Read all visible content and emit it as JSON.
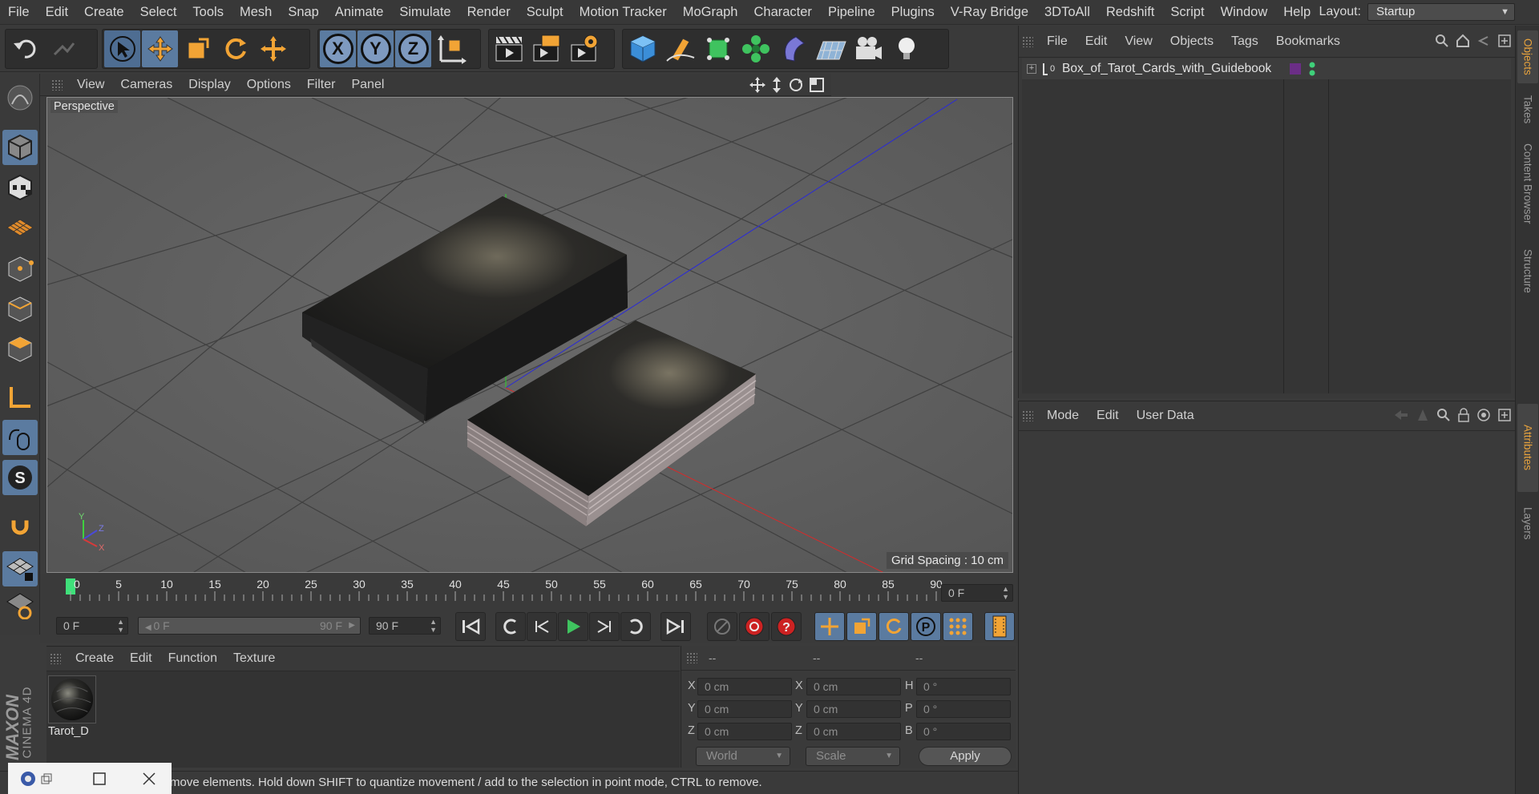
{
  "menubar": {
    "items": [
      "File",
      "Edit",
      "Create",
      "Select",
      "Tools",
      "Mesh",
      "Snap",
      "Animate",
      "Simulate",
      "Render",
      "Sculpt",
      "Motion Tracker",
      "MoGraph",
      "Character",
      "Pipeline",
      "Plugins",
      "V-Ray Bridge",
      "3DToAll",
      "Redshift",
      "Script",
      "Window",
      "Help"
    ],
    "layout_label": "Layout:",
    "layout_value": "Startup"
  },
  "toolbar": {
    "undo_icon": "undo-icon",
    "redo_icon": "redo-icon",
    "axis_x": "X",
    "axis_y": "Y",
    "axis_z": "Z"
  },
  "viewport": {
    "menu": [
      "View",
      "Cameras",
      "Display",
      "Options",
      "Filter",
      "Panel"
    ],
    "camera_label": "Perspective",
    "grid_spacing": "Grid Spacing : 10 cm",
    "axis_labels": {
      "y": "Y",
      "z": "Z",
      "x": "X"
    }
  },
  "timeline": {
    "ticks": [
      "0",
      "5",
      "10",
      "15",
      "20",
      "25",
      "30",
      "35",
      "40",
      "45",
      "50",
      "55",
      "60",
      "65",
      "70",
      "75",
      "80",
      "85",
      "90"
    ],
    "current_frame": "0 F"
  },
  "playback": {
    "start_frame": "0 F",
    "range_start": "0 F",
    "range_end": "90 F",
    "end_frame": "90 F"
  },
  "material_manager": {
    "menu": [
      "Create",
      "Edit",
      "Function",
      "Texture"
    ],
    "materials": [
      {
        "name": "Tarot_D"
      }
    ]
  },
  "coordinates": {
    "headers": [
      "--",
      "--",
      "--"
    ],
    "labels_pos": [
      "X",
      "Y",
      "Z"
    ],
    "labels_size": [
      "X",
      "Y",
      "Z"
    ],
    "labels_rot": [
      "H",
      "P",
      "B"
    ],
    "pos": [
      "0 cm",
      "0 cm",
      "0 cm"
    ],
    "size": [
      "0 cm",
      "0 cm",
      "0 cm"
    ],
    "rot": [
      "0 °",
      "0 °",
      "0 °"
    ],
    "mode_world": "World",
    "mode_scale": "Scale",
    "apply": "Apply"
  },
  "statusbar": {
    "text": "move elements. Hold down SHIFT to quantize movement / add to the selection in point mode, CTRL to remove."
  },
  "object_manager": {
    "menu": [
      "File",
      "Edit",
      "View",
      "Objects",
      "Tags",
      "Bookmarks"
    ],
    "objects": [
      {
        "name": "Box_of_Tarot_Cards_with_Guidebook",
        "layer_color": "#6b2e86",
        "visibility_color": "#3fd07a"
      }
    ]
  },
  "attribute_manager": {
    "menu": [
      "Mode",
      "Edit",
      "User Data"
    ]
  },
  "right_tabs": [
    "Objects",
    "Takes",
    "Content Browser",
    "Structure",
    "Attributes",
    "Layers"
  ],
  "branding": {
    "line1": "MAXON",
    "line2": "CINEMA 4D"
  },
  "colors": {
    "accent": "#5b7ba0",
    "active_tab": "#e8a33d",
    "play_green": "#3fc35f",
    "record_red": "#d33"
  }
}
